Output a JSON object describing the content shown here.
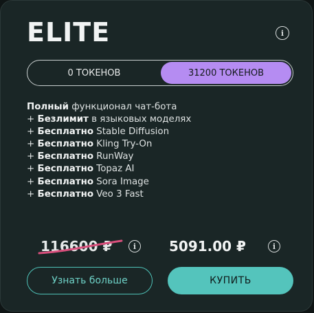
{
  "plan": {
    "title": "ELITE",
    "info_icon": "info-icon"
  },
  "toggle": {
    "left_label": "0 ТОКЕНОВ",
    "right_label": "31200 ТОКЕНОВ",
    "selected": "right"
  },
  "features": [
    {
      "bold": "Полный",
      "rest": " функционал чат-бота",
      "prefix": ""
    },
    {
      "bold": "Безлимит",
      "rest": " в языковых моделях",
      "prefix": "+ "
    },
    {
      "bold": "Бесплатно",
      "rest": " Stable Diffusion",
      "prefix": "+ "
    },
    {
      "bold": "Бесплатно",
      "rest": " Kling Try-On",
      "prefix": "+ "
    },
    {
      "bold": "Бесплатно",
      "rest": " RunWay",
      "prefix": "+ "
    },
    {
      "bold": "Бесплатно",
      "rest": " Topaz AI",
      "prefix": "+ "
    },
    {
      "bold": "Бесплатно",
      "rest": " Sora Image",
      "prefix": "+ "
    },
    {
      "bold": "Бесплатно",
      "rest": " Veo 3 Fast",
      "prefix": "+ "
    }
  ],
  "pricing": {
    "old_price": "116600 ₽",
    "new_price": "5091.00 ₽"
  },
  "buttons": {
    "more_label": "Узнать больше",
    "buy_label": "КУПИТЬ"
  },
  "colors": {
    "accent_purple": "#b58cf2",
    "accent_teal": "#54c4bc",
    "strike_red": "#d94f7c",
    "card_bg": "#1a2626"
  }
}
